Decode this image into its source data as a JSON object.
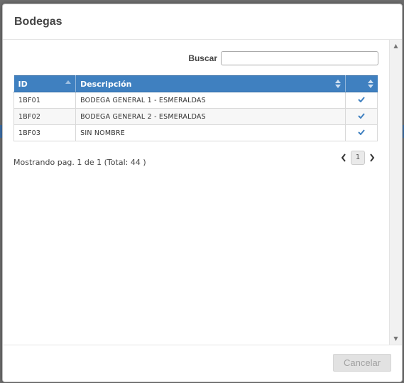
{
  "modal": {
    "title": "Bodegas"
  },
  "search": {
    "label": "Buscar",
    "value": "",
    "placeholder": ""
  },
  "table": {
    "columns": [
      "ID",
      "Descripción",
      ""
    ],
    "rows": [
      {
        "id": "1BF01",
        "description": "BODEGA GENERAL 1 - ESMERALDAS",
        "checked": true
      },
      {
        "id": "1BF02",
        "description": "BODEGA GENERAL 2 - ESMERALDAS",
        "checked": true
      },
      {
        "id": "1BF03",
        "description": "SIN NOMBRE",
        "checked": true
      }
    ]
  },
  "pagination": {
    "info": "Mostrando pag. 1 de 1 (Total: 44 )",
    "current_page": "1"
  },
  "footer": {
    "cancel_label": "Cancelar"
  },
  "colors": {
    "header_blue": "#3f80c0",
    "check_blue": "#3f80c0"
  },
  "icons": {
    "sort_asc": "sort-asc-icon",
    "sort_both": "sort-icon",
    "check": "check-icon",
    "prev": "chevron-left-icon",
    "next": "chevron-right-icon"
  }
}
